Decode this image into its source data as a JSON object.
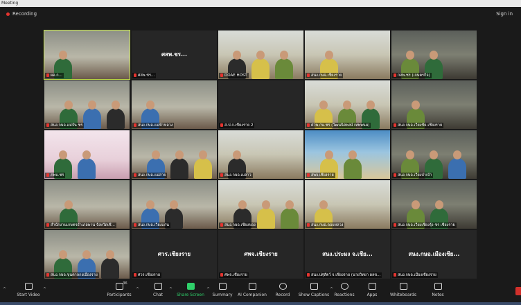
{
  "window": {
    "title": "Meeting"
  },
  "topbar": {
    "recording_label": "Recording",
    "signin_label": "Sign in"
  },
  "tiles": [
    {
      "label": "ผอ.ก...",
      "kind": "video",
      "active": true
    },
    {
      "label": "ศสพ.ชร...",
      "center": "ศสพ.ชร...",
      "kind": "name"
    },
    {
      "label": "DOAE HOST",
      "kind": "video"
    },
    {
      "label": "สนง.กษจ.เชียงราย",
      "kind": "video"
    },
    {
      "label": "กสพ.ชร (เกษตรกิจ)",
      "kind": "video"
    },
    {
      "label": "สนง.กษอ.แม่จัน ชร",
      "kind": "video"
    },
    {
      "label": "สนง.กษอ.แม่ฟ้าหลวง",
      "kind": "video"
    },
    {
      "label": "ส.ป.ก.เชียงราย 2",
      "kind": "blank"
    },
    {
      "label": "ศวพ.กษ.ชร (วัฒนนิคพงษ์ เทพพนม)",
      "kind": "video"
    },
    {
      "label": "สนง.กษอ.เวียงชัย-เชียงราย",
      "kind": "video"
    },
    {
      "label": "ภพบ.ชร",
      "kind": "video"
    },
    {
      "label": "สนง.กษอ.แม่สาย",
      "kind": "video"
    },
    {
      "label": "สนง.กษอ.เมลาว",
      "kind": "video"
    },
    {
      "label": "สพจ.เชียงราย",
      "kind": "video"
    },
    {
      "label": "สนง.กษอ.เวียงป่าเป้า",
      "kind": "video"
    },
    {
      "label": "สำนักงานเกษตรอำเภอพาน จังหวัดเชี...",
      "kind": "video"
    },
    {
      "label": "สนง.กษอ.เวียงแก่น",
      "kind": "video"
    },
    {
      "label": "สนง.กษอ.เชียงของ",
      "kind": "video"
    },
    {
      "label": "สนง.กษอ.ดอยหลวง",
      "kind": "video"
    },
    {
      "label": "สนง.กษอ.เวียงเชียงรุ้ง ชร เชียงราย",
      "kind": "video"
    },
    {
      "label": "สนง.กษอ.ขุนตาลกงเมืองราย",
      "kind": "video"
    },
    {
      "label": "ศวร.เชียงราย",
      "center": "ศวร.เชียงราย",
      "kind": "name"
    },
    {
      "label": "ศพจ.เชียงราย",
      "center": "ศพจ.เชียงราย",
      "kind": "name"
    },
    {
      "label": "สนง.ปศุสัตว์ จ.เชียงราย (นายวิทยา ผลข...",
      "center": "สนง.ประมง จ.เชีย...",
      "kind": "name"
    },
    {
      "label": "สนง.กษอ.เมืองเชียงราย",
      "center": "สนง.กษอ.เมืองเชีย...",
      "kind": "name"
    }
  ],
  "toolbar": {
    "start_video": "Start Video",
    "participants": "Participants",
    "participants_count": "36",
    "chat": "Chat",
    "share_screen": "Share Screen",
    "summary": "Summary",
    "ai_companion": "AI Companion",
    "record": "Record",
    "show_captions": "Show Captions",
    "reactions": "Reactions",
    "apps": "Apps",
    "whiteboards": "Whiteboards",
    "notes": "Notes"
  },
  "colors": {
    "accent_green": "#2fd06a",
    "active_border": "#c8e64a",
    "record_red": "#e5342f"
  }
}
